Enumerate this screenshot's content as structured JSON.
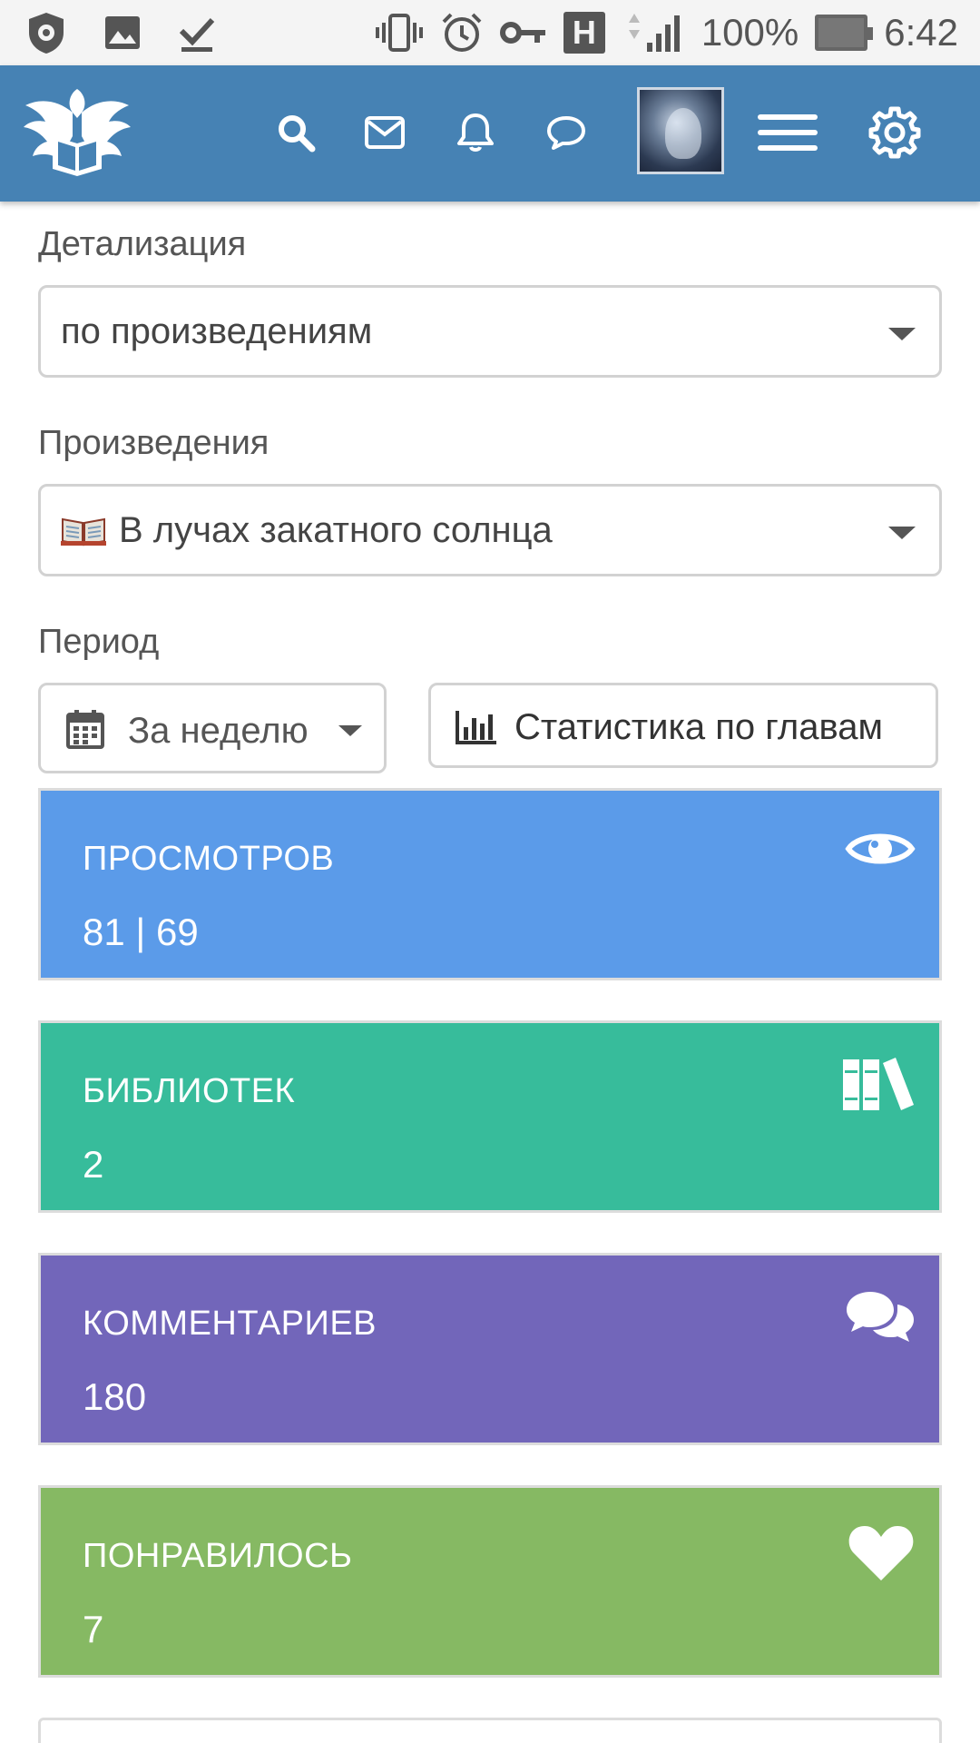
{
  "status_bar": {
    "battery_percent": "100%",
    "time": "6:42",
    "network_indicator": "H",
    "icons": [
      "shield-icon",
      "image-icon",
      "download-done-icon",
      "vibrate-icon",
      "alarm-icon",
      "vpn-key-icon",
      "signal-icon",
      "battery-icon"
    ]
  },
  "header": {
    "icons": [
      "logo-eagle-book",
      "search-icon",
      "mail-icon",
      "bell-icon",
      "chat-bubble-icon",
      "avatar",
      "hamburger-menu-icon",
      "gear-icon"
    ],
    "accent_color": "#4682b4"
  },
  "form": {
    "detail_label": "Детализация",
    "detail_value": "по произведениям",
    "works_label": "Произведения",
    "works_value": "В лучах закатного солнца",
    "period_label": "Период",
    "period_value": "За неделю",
    "stats_button_label": "Статистика по главам"
  },
  "cards": [
    {
      "title": "ПРОСМОТРОВ",
      "value": "81 | 69",
      "icon": "eye-icon",
      "color": "#5b9be9"
    },
    {
      "title": "БИБЛИОТЕК",
      "value": "2",
      "icon": "books-icon",
      "color": "#37bc9b"
    },
    {
      "title": "КОММЕНТАРИЕВ",
      "value": "180",
      "icon": "comments-icon",
      "color": "#7266ba"
    },
    {
      "title": "ПОНРАВИЛОСЬ",
      "value": "7",
      "icon": "heart-icon",
      "color": "#86b963"
    }
  ]
}
